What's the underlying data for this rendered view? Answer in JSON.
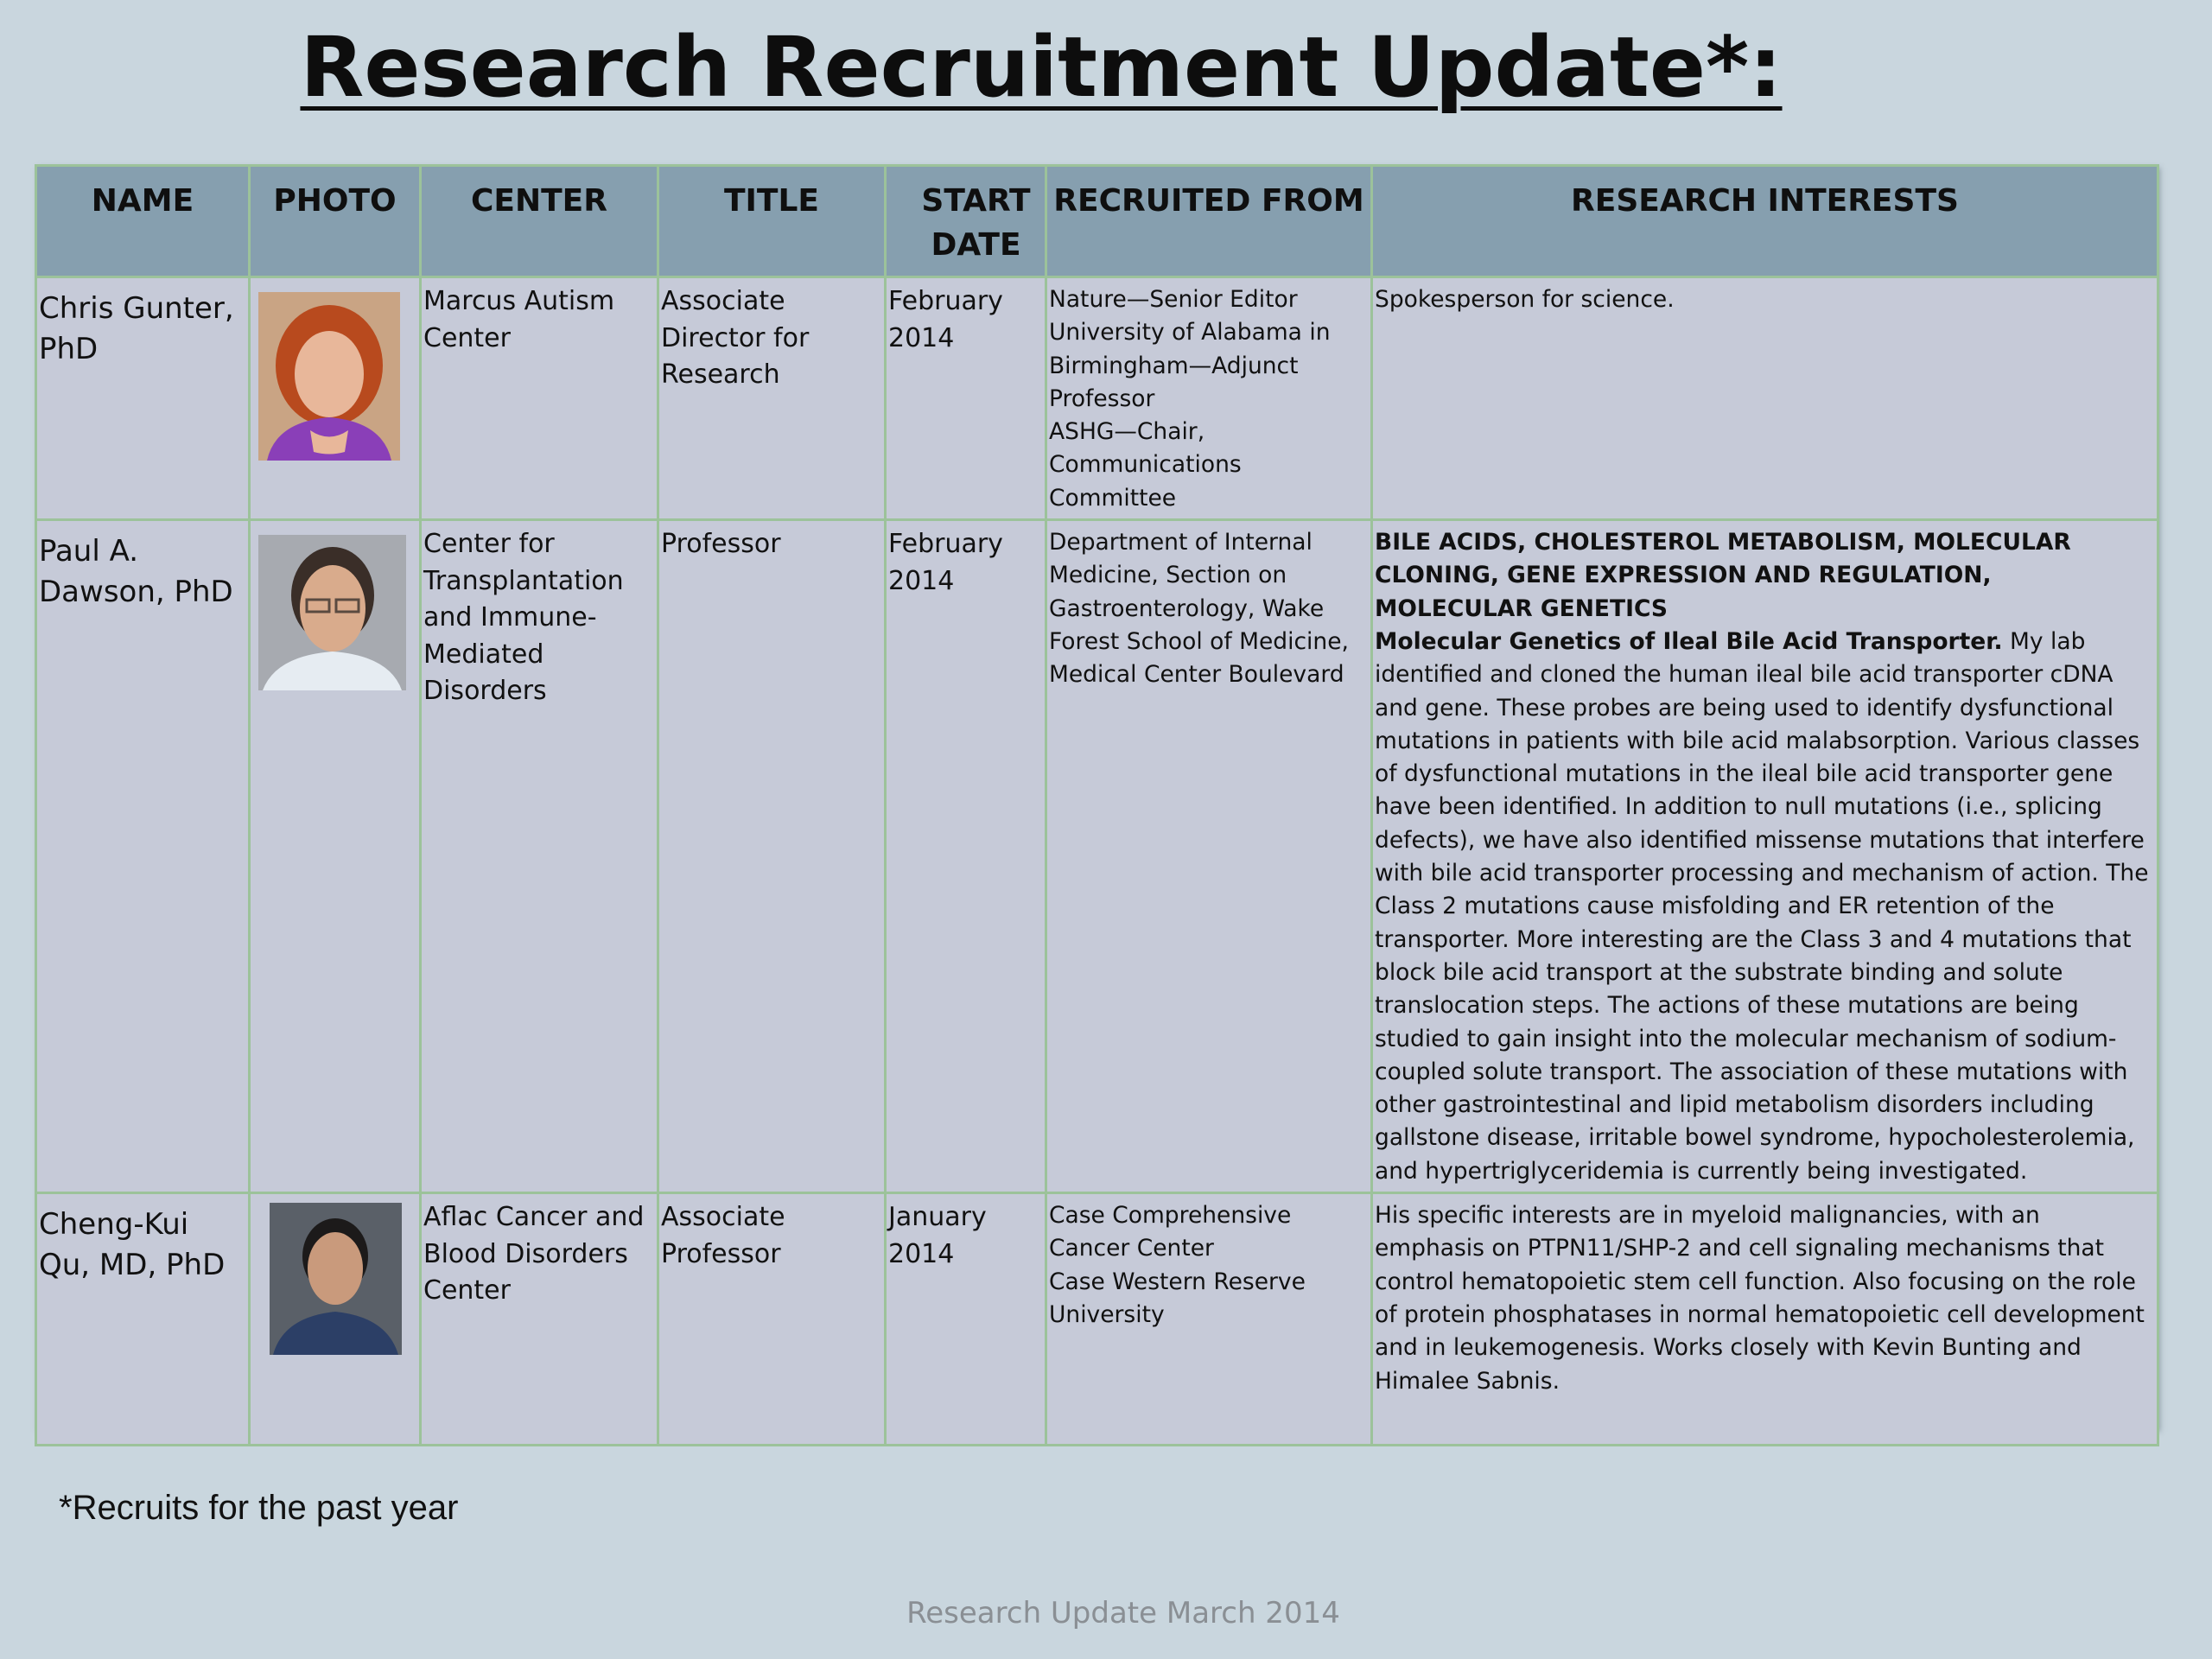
{
  "page": {
    "title": "Research Recruitment Update*:",
    "footnote": "*Recruits for the past year",
    "footer": "Research Update March 2014"
  },
  "table": {
    "headers": [
      "NAME",
      "PHOTO",
      "CENTER",
      "TITLE",
      "START DATE",
      "RECRUITED FROM",
      "RESEARCH INTERESTS"
    ],
    "rows": [
      {
        "name": "Chris Gunter, PhD",
        "center": "Marcus Autism Center",
        "title": "Associate Director for Research",
        "start_date": "February 2014",
        "recruited_from": [
          "Nature—Senior Editor",
          "University of Alabama in Birmingham—Adjunct Professor",
          "ASHG—Chair, Communications Committee"
        ],
        "research_interests": {
          "heading": "",
          "subheading": "",
          "body": "Spokesperson for science."
        }
      },
      {
        "name": "Paul A. Dawson, PhD",
        "center": "Center for Transplantation and Immune-Mediated Disorders",
        "title": "Professor",
        "start_date": "February 2014",
        "recruited_from": [
          "Department of Internal Medicine, Section on Gastroenterology, Wake Forest School of Medicine, Medical Center Boulevard"
        ],
        "research_interests": {
          "heading": "BILE ACIDS, CHOLESTEROL METABOLISM, MOLECULAR CLONING, GENE EXPRESSION AND REGULATION, MOLECULAR GENETICS",
          "subheading": "Molecular Genetics of Ileal Bile Acid Transporter.",
          "body": " My lab identified and cloned the human ileal bile acid transporter cDNA and gene. These probes are being used to identify dysfunctional mutations in patients with bile acid malabsorption. Various classes of dysfunctional mutations in the ileal bile acid transporter gene have been identified. In addition to null mutations (i.e., splicing defects), we have also identified missense mutations that interfere with bile acid transporter processing and mechanism of action. The Class 2 mutations cause misfolding and ER retention of the transporter. More interesting are the Class 3 and 4 mutations that block bile acid transport at the substrate binding and solute translocation steps. The actions of these mutations are being studied to gain insight into the molecular mechanism of sodium-coupled solute transport. The association of these mutations with other gastrointestinal and lipid metabolism disorders including gallstone disease, irritable bowel syndrome, hypocholesterolemia, and hypertriglyceridemia is currently being investigated."
        }
      },
      {
        "name": "Cheng-Kui Qu, MD, PhD",
        "center": "Aflac Cancer and Blood Disorders Center",
        "title": "Associate Professor",
        "start_date": "January 2014",
        "recruited_from": [
          "Case Comprehensive Cancer Center",
          "Case Western Reserve University"
        ],
        "research_interests": {
          "heading": "",
          "subheading": "",
          "body": "His specific interests are in myeloid malignancies, with an emphasis on PTPN11/SHP-2 and cell signaling mechanisms that control hematopoietic stem cell function. Also focusing on the role of protein phosphatases in normal hematopoietic cell development and in leukemogenesis. Works closely with Kevin Bunting and Himalee Sabnis."
        }
      }
    ]
  },
  "colors": {
    "background": "#c9d6de",
    "header_fill": "#869faf",
    "cell_fill": "#c6cad8",
    "grid_line": "#9cc29a",
    "footer_text": "#8a8f94"
  }
}
